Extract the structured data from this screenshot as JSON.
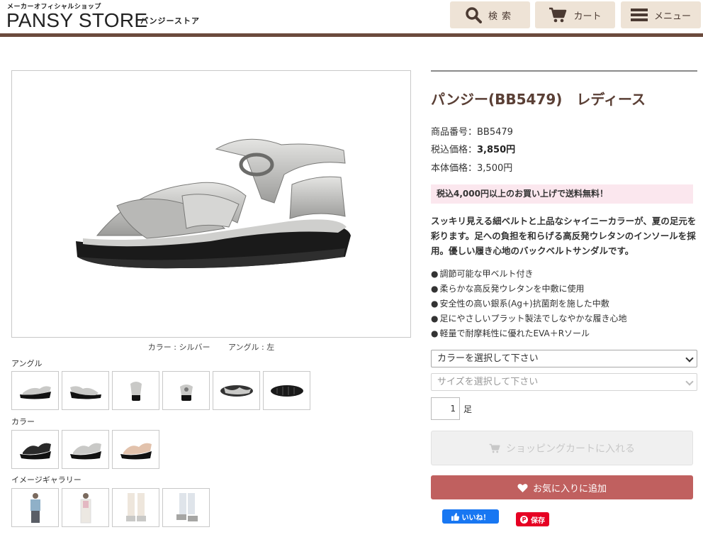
{
  "header": {
    "tagline": "メーカーオフィシャルショップ",
    "logo": "PANSY STORE",
    "logo_sub": "パンジーストア",
    "search_label": "検索",
    "cart_label": "カート",
    "menu_label": "メニュー"
  },
  "gallery": {
    "caption_color": "カラー : シルバー",
    "caption_angle": "アングル : 左",
    "angle_label": "アングル",
    "color_label": "カラー",
    "image_label": "イメージギャラリー"
  },
  "product": {
    "title": "パンジー(BB5479)　レディース",
    "code_label": "商品番号：",
    "code": "BB5479",
    "tax_label": "税込価格：",
    "tax_price": "3,850円",
    "base_label": "本体価格：",
    "base_price": "3,500円",
    "shipping": "税込4,000円以上のお買い上げで送料無料！",
    "description": "スッキリ見える細ベルトと上品なシャイニーカラーが、夏の足元を彩ります。足への負担を和らげる高反発ウレタンのインソールを採用。優しい履き心地のバックベルトサンダルです。",
    "features": [
      "調節可能な甲ベルト付き",
      "柔らかな高反発ウレタンを中敷に使用",
      "安全性の高い銀系(Ag+)抗菌剤を施した中敷",
      "足にやさしいプラット製法でしなやかな履き心地",
      "軽量で耐摩耗性に優れたEVA＋Rソール"
    ]
  },
  "form": {
    "color_select": "カラーを選択して下さい",
    "size_select": "サイズを選択して下さい",
    "quantity": "1",
    "quantity_unit": "足",
    "cart_button": "ショッピングカートに入れる",
    "favorite_button": "お気に入りに追加"
  },
  "social": {
    "like": "いいね！",
    "pin": "保存"
  },
  "colors": {
    "brand_brown": "#6b4a3c",
    "header_button_bg": "#eee3d6",
    "favorite_red": "#c0605f",
    "shipping_bg": "#fbe7ee"
  }
}
